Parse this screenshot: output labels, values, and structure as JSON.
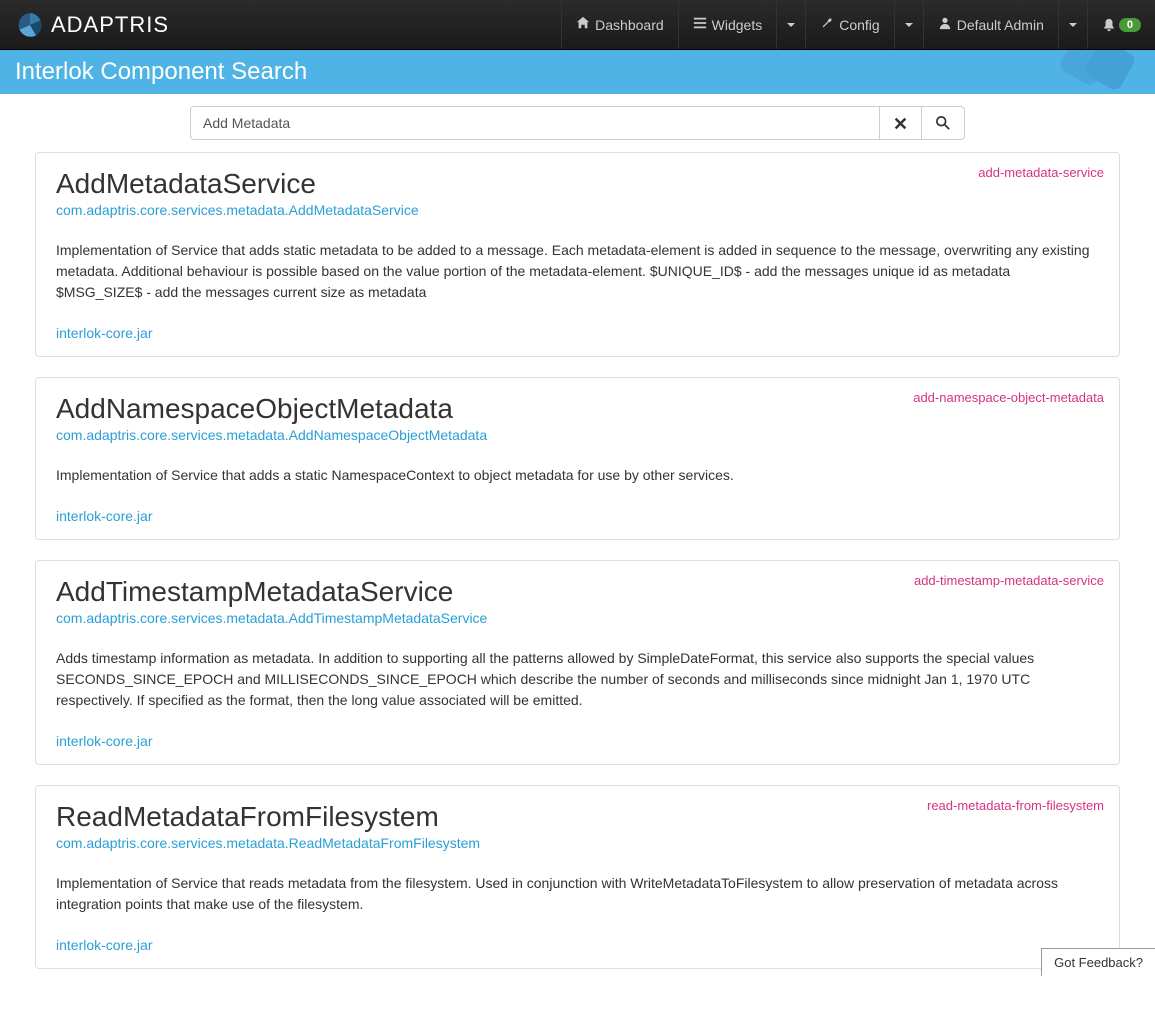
{
  "brand": "ADAPTRIS",
  "nav": {
    "dashboard": "Dashboard",
    "widgets": "Widgets",
    "config": "Config",
    "user": "Default Admin",
    "notif_count": "0"
  },
  "page_title": "Interlok Component Search",
  "search": {
    "value": "Add Metadata",
    "placeholder": ""
  },
  "results": [
    {
      "title": "AddMetadataService",
      "tag": "add-metadata-service",
      "fqcn": "com.adaptris.core.services.metadata.AddMetadataService",
      "desc": "Implementation of Service that adds static metadata to be added to a message. Each metadata-element is added in sequence to the message, overwriting any existing metadata. Additional behaviour is possible based on the value portion of the metadata-element. $UNIQUE_ID$ - add the messages unique id as metadata $MSG_SIZE$ - add the messages current size as metadata",
      "jar": "interlok-core.jar"
    },
    {
      "title": "AddNamespaceObjectMetadata",
      "tag": "add-namespace-object-metadata",
      "fqcn": "com.adaptris.core.services.metadata.AddNamespaceObjectMetadata",
      "desc": "Implementation of Service that adds a static NamespaceContext to object metadata for use by other services.",
      "jar": "interlok-core.jar"
    },
    {
      "title": "AddTimestampMetadataService",
      "tag": "add-timestamp-metadata-service",
      "fqcn": "com.adaptris.core.services.metadata.AddTimestampMetadataService",
      "desc": "Adds timestamp information as metadata. In addition to supporting all the patterns allowed by SimpleDateFormat, this service also supports the special values SECONDS_SINCE_EPOCH and MILLISECONDS_SINCE_EPOCH which describe the number of seconds and milliseconds since midnight Jan 1, 1970 UTC respectively. If specified as the format, then the long value associated will be emitted.",
      "jar": "interlok-core.jar"
    },
    {
      "title": "ReadMetadataFromFilesystem",
      "tag": "read-metadata-from-filesystem",
      "fqcn": "com.adaptris.core.services.metadata.ReadMetadataFromFilesystem",
      "desc": "Implementation of Service that reads metadata from the filesystem. Used in conjunction with WriteMetadataToFilesystem to allow preservation of metadata across integration points that make use of the filesystem.",
      "jar": "interlok-core.jar"
    }
  ],
  "feedback": "Got Feedback?"
}
